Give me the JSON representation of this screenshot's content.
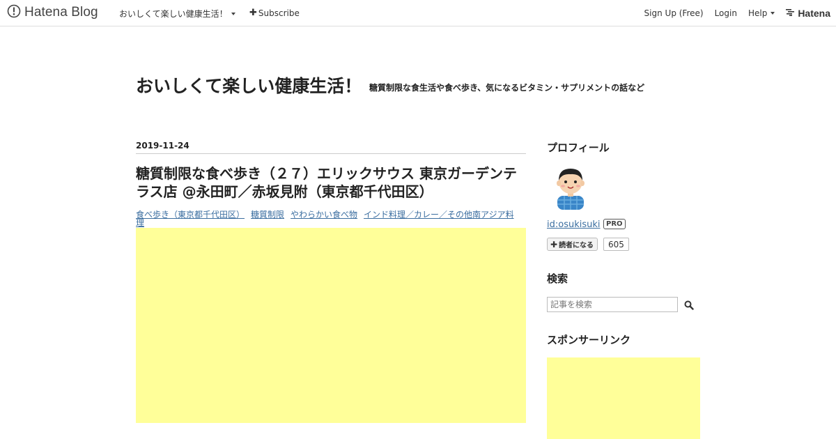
{
  "globalheader": {
    "brand": "Hatena Blog",
    "blog_name": "おいしくて楽しい健康生活！",
    "subscribe_label": "Subscribe",
    "signup_label": "Sign Up (Free)",
    "login_label": "Login",
    "help_label": "Help",
    "hatena_label": "Hatena"
  },
  "blog": {
    "title": "おいしくて楽しい健康生活！",
    "description": "糖質制限な食生活や食べ歩き、気になるビタミン・サプリメントの話など"
  },
  "entry": {
    "date": "2019-11-24",
    "title": "糖質制限な食べ歩き（２７）エリックサウス 東京ガーデンテラス店 @永田町／赤坂見附（東京都千代田区）",
    "categories": [
      "食べ歩き（東京都千代田区）",
      "糖質制限",
      "やわらかい食べ物",
      "インド料理／カレー／その他南アジア料理"
    ]
  },
  "sidebar": {
    "profile_heading": "プロフィール",
    "profile_id": "id:osukisuki",
    "pro_badge": "PRO",
    "subscribe_button": "読者になる",
    "subscriber_count": "605",
    "search_heading": "検索",
    "search_placeholder": "記事を検索",
    "sponsor_heading": "スポンサーリンク"
  },
  "icons": {
    "logo": "hatena-blog-logo-icon",
    "search": "search-icon",
    "avatar": "avatar-boy-icon"
  },
  "colors": {
    "link": "#3b6ea0",
    "ad_placeholder": "#ffff99"
  }
}
